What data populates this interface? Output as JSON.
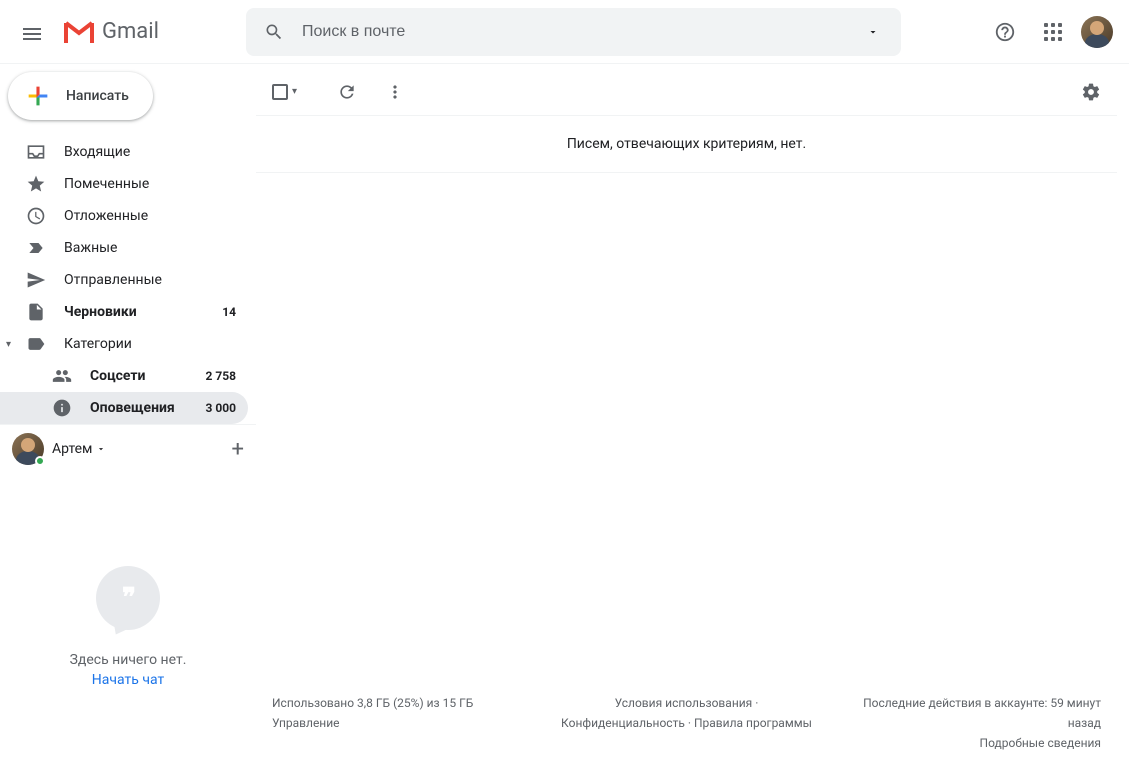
{
  "header": {
    "app_name": "Gmail",
    "search_placeholder": "Поиск в почте"
  },
  "compose_label": "Написать",
  "sidebar": {
    "items": [
      {
        "label": "Входящие",
        "count": "",
        "bold": false
      },
      {
        "label": "Помеченные",
        "count": "",
        "bold": false
      },
      {
        "label": "Отложенные",
        "count": "",
        "bold": false
      },
      {
        "label": "Важные",
        "count": "",
        "bold": false
      },
      {
        "label": "Отправленные",
        "count": "",
        "bold": false
      },
      {
        "label": "Черновики",
        "count": "14",
        "bold": true
      },
      {
        "label": "Категории",
        "count": "",
        "bold": false
      },
      {
        "label": "Соцсети",
        "count": "2 758",
        "bold": true,
        "sub": true
      },
      {
        "label": "Оповещения",
        "count": "3 000",
        "bold": true,
        "sub": true
      }
    ]
  },
  "hangouts": {
    "user_name": "Артем",
    "empty_text": "Здесь ничего нет.",
    "start_chat": "Начать чат"
  },
  "main": {
    "empty_message": "Писем, отвечающих критериям, нет."
  },
  "footer": {
    "storage": "Использовано 3,8 ГБ (25%) из 15 ГБ",
    "manage": "Управление",
    "terms": "Условия использования",
    "privacy": "Конфиденциальность",
    "program": "Правила программы",
    "activity": "Последние действия в аккаунте: 59 минут назад",
    "details": "Подробные сведения"
  }
}
